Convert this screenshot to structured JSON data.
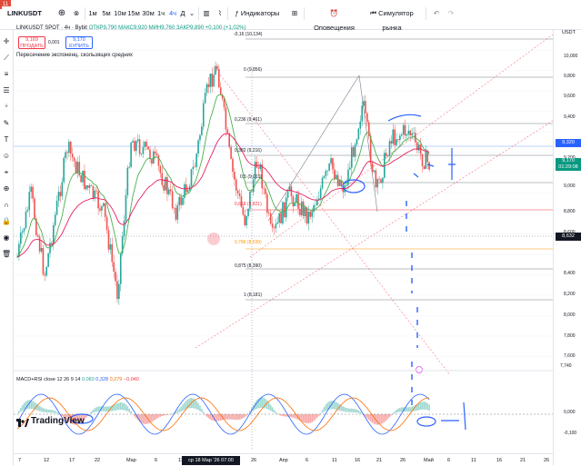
{
  "top_bar": {
    "symbol": "LINKUSDT",
    "timeframes": [
      "1м",
      "5м",
      "10м",
      "15м",
      "30м",
      "1ч",
      "4ч",
      "Д"
    ],
    "active_timeframe": "4ч",
    "indicators_label": "Индикаторы",
    "alerts_label": "Оповещения",
    "replay_label": "Симулятор рынка",
    "notification_count": "11"
  },
  "legend": {
    "title": "LINKUSDT SPOT · 4ч · Bybit",
    "ohlc": "ОТКР9,790 МАКС9,920 МИН9,760 ЗАКР9,890 +0,100 (+1,02%)",
    "sell_price": "9,169",
    "sell_label": "ПРОДАТЬ",
    "spread": "0,001",
    "buy_price": "9,170",
    "buy_label": "КУПИТЬ",
    "indicator_name": "Пересечение экспоненц. скользящих средних"
  },
  "price_axis": {
    "currency": "USDT",
    "labels": [
      "10,000",
      "9,800",
      "9,600",
      "9,400",
      "9,200",
      "9,000",
      "8,800",
      "8,600",
      "8,400",
      "8,200",
      "8,000",
      "7,800",
      "7,600"
    ],
    "tag_blue": "9,320",
    "tag_current": "9,170",
    "tag_timer": "01:29:08",
    "tag_dark": "8,632",
    "tag_small": "7,740"
  },
  "fib_levels": [
    {
      "label": "-0,16 (10,134)"
    },
    {
      "label": "0 (9,856)"
    },
    {
      "label": "0,236 (9,461)"
    },
    {
      "label": "0,382 (9,216)"
    },
    {
      "label": "0,5 (9,019)"
    },
    {
      "label": "0,618 (8,821)"
    },
    {
      "label": "0,786 (8,539)"
    },
    {
      "label": "0,875 (8,390)"
    },
    {
      "label": "1 (8,181)"
    }
  ],
  "macd": {
    "label": "MACD+RSI close 12 26 9 14",
    "v0": "0,083",
    "v1": "0,328",
    "v2": "0,279",
    "v3": "−0,040",
    "axis": [
      "0,000",
      "-0,100"
    ]
  },
  "time_axis": {
    "ticks": [
      "7",
      "12",
      "17",
      "22",
      "Мар",
      "6",
      "11",
      "26",
      "Апр",
      "6",
      "11",
      "16",
      "21",
      "26",
      "Май",
      "6",
      "11",
      "16",
      "21",
      "26"
    ],
    "selected_date": "ср 18 Мар '26  07:00"
  },
  "brand": "TradingView",
  "colors": {
    "up": "#26a69a",
    "down": "#ef5350",
    "ema_fast": "#4caf50",
    "ema_slow": "#e91e63",
    "accent": "#2962ff"
  }
}
